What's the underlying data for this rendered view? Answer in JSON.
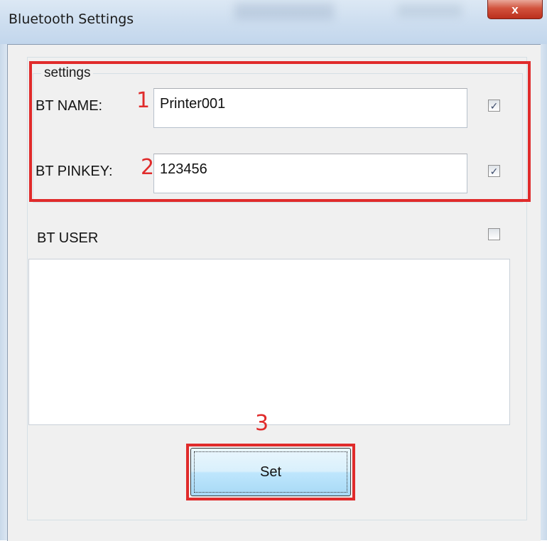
{
  "window": {
    "title": "Bluetooth Settings",
    "close_label": "x"
  },
  "settings_group": {
    "legend": "settings",
    "bt_name": {
      "label": "BT NAME:",
      "value": "Printer001",
      "checked": true
    },
    "bt_pinkey": {
      "label": "BT PINKEY:",
      "value": "123456",
      "checked": true
    }
  },
  "bt_user": {
    "label": "BT USER",
    "checked": false,
    "items": []
  },
  "set_button": {
    "label": "Set"
  },
  "annotations": {
    "marker_1": "1",
    "marker_2": "2",
    "marker_3": "3",
    "color": "#e02b2b"
  }
}
